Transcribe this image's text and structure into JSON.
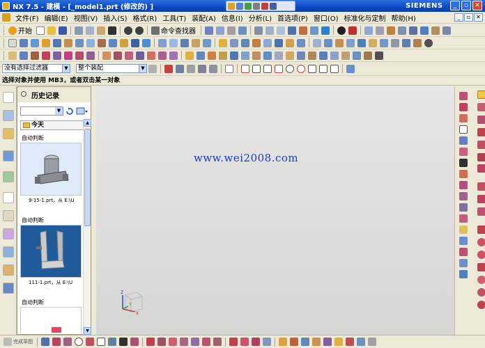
{
  "window": {
    "title": "NX 7.5 - 建模 - [_model1.prt  (修改的) ]",
    "brand": "SIEMENS",
    "buttons": [
      "_",
      "▫",
      "✕"
    ]
  },
  "menu": {
    "items": [
      "文件(F)",
      "编辑(E)",
      "视图(V)",
      "插入(S)",
      "格式(R)",
      "工具(T)",
      "装配(A)",
      "信息(I)",
      "分析(L)",
      "首选项(P)",
      "窗口(O)",
      "标准化与定制",
      "帮助(H)"
    ]
  },
  "toolbar": {
    "start_label": "开始",
    "command_finder": "命令查找器"
  },
  "selection_bar": {
    "filter": "没有选择过滤器",
    "scope": "整个装配"
  },
  "cue": "选择对象并使用 MB3，或者双击某一对象",
  "history": {
    "title": "历史记录",
    "group": "今天",
    "entries": [
      {
        "label": "自动判断",
        "caption": "9-15-1.prt，从 E:\\U"
      },
      {
        "label": "自动判断",
        "caption": "111-1.prt，从 E:\\U"
      },
      {
        "label": "自动判断",
        "caption": ""
      }
    ]
  },
  "canvas": {
    "watermark": "www.wei2008.com",
    "axes": {
      "x": "X",
      "y": "Y",
      "z": "Z"
    }
  },
  "status": {
    "finish_sketch": "完成草图"
  },
  "colors": {
    "title_bar": "#0a4ac2",
    "toolbar_bg": "#ECE9D8",
    "canvas_top": "#e6e6e4",
    "watermark": "#1a3cc8"
  }
}
